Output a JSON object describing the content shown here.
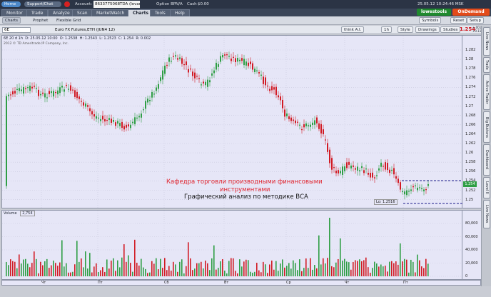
{
  "topbar": {
    "home": "Home",
    "support": "Support/Chat",
    "account_label": "Account:",
    "account_value": "8633775068TDA (Ievanina)",
    "option_bp": "Option BP",
    "na1": "N/A",
    "cash_label": "Cash",
    "cash_value": "$0.00",
    "thinkorswim": "lowestools",
    "ondemand": "OnDemand",
    "datetime": "25.05.12 10:24:46 MSK"
  },
  "navtabs": [
    "Monitor",
    "Trade",
    "Analyze",
    "Scan",
    "MarketWatch",
    "Charts",
    "Tools",
    "Help"
  ],
  "active_tab": "Charts",
  "subbar": {
    "charts": "Charts",
    "prophet": "Prophet",
    "flexible_grid": "Flexible Grid",
    "symbols": "Symbols",
    "reset": "Reset",
    "setup": "Setup"
  },
  "chartbar": {
    "symbol": "6E",
    "description": "Euro FX Futures,ETH (JUN4 12)",
    "thinkai": "think A.I.",
    "aggregation": "1h",
    "style": "Style",
    "drawings": "Drawings",
    "studies": "Studies",
    "last": "1.254",
    "change_top": "+.0014",
    "change_bottom": "+0.11%"
  },
  "ohlc": {
    "period": "6E 20 d 1h",
    "date": "D: 25.05.12 10:00",
    "open": "O: 1.2538",
    "high": "H: 1.2543",
    "low": "L: 1.2523",
    "close": "C: 1.254",
    "range": "R: 0.002"
  },
  "copyright": "2012 © TD Ameritrade IP Company, Inc.",
  "annotations": {
    "red_line1": "Кафедра торговли производными финансовыми",
    "red_line2": "инструментами",
    "black_line": "Графический анализ по методике ВСА"
  },
  "low_label": "Lo: 1.2516",
  "price_badge": "1.254",
  "volume": {
    "label": "Volume",
    "value": "2,754"
  },
  "price_ticks": [
    "1.282",
    "1.28",
    "1.278",
    "1.276",
    "1.274",
    "1.272",
    "1.27",
    "1.268",
    "1.266",
    "1.264",
    "1.262",
    "1.26",
    "1.258",
    "1.256",
    "1.254",
    "1.252",
    "1.25"
  ],
  "volume_ticks": [
    "80,000",
    "60,000",
    "40,000",
    "20,000",
    "0"
  ],
  "date_labels": [
    "Чт",
    "Пт",
    "Сб",
    "Вт",
    "Ср",
    "Чт",
    "Пт"
  ],
  "sidetabs": [
    "Live News",
    "Trade",
    "Active Trader",
    "Big Buttons",
    "Dashboard",
    "Level II",
    "Live News"
  ],
  "colors": {
    "up": "#2f9e45",
    "down": "#d11b24",
    "pane_bg": "#e6e6f7",
    "nav_bg": "#2b3445",
    "annot_red": "#e0242e"
  }
}
